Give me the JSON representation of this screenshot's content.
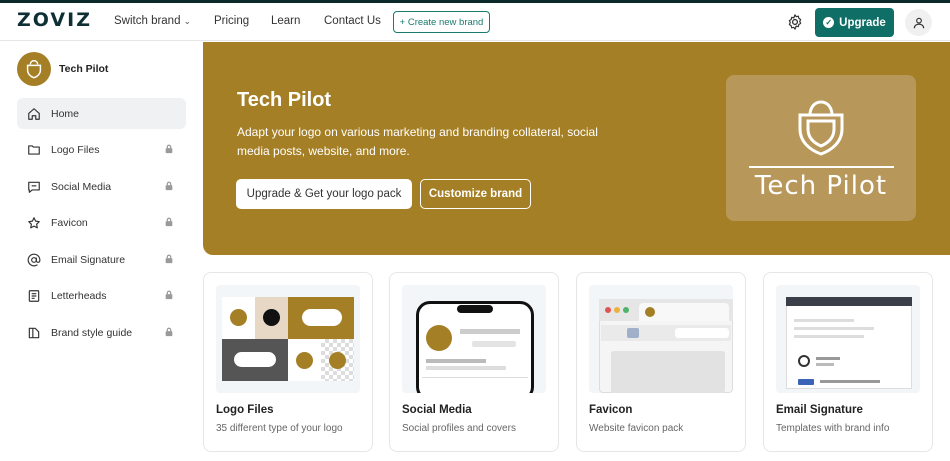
{
  "nav": {
    "logo": "ZOVIZ",
    "switch_brand": "Switch brand",
    "pricing": "Pricing",
    "learn": "Learn",
    "contact": "Contact Us",
    "create": "+ Create new brand",
    "upgrade": "Upgrade"
  },
  "sidebar": {
    "brand_name": "Tech Pilot",
    "items": [
      {
        "label": "Home",
        "icon": "home-icon",
        "locked": false
      },
      {
        "label": "Logo Files",
        "icon": "folder-icon",
        "locked": true
      },
      {
        "label": "Social Media",
        "icon": "chat-icon",
        "locked": true
      },
      {
        "label": "Favicon",
        "icon": "star-icon",
        "locked": true
      },
      {
        "label": "Email Signature",
        "icon": "at-icon",
        "locked": true
      },
      {
        "label": "Letterheads",
        "icon": "document-icon",
        "locked": true
      },
      {
        "label": "Brand style guide",
        "icon": "book-icon",
        "locked": true
      }
    ]
  },
  "hero": {
    "title": "Tech Pilot",
    "description": "Adapt your logo on various marketing and branding collateral, social media posts, website, and more.",
    "primary_button": "Upgrade & Get your logo pack",
    "secondary_button": "Customize brand",
    "preview_name": "Tech Pilot"
  },
  "cards": [
    {
      "title": "Logo Files",
      "subtitle": "35 different type of your logo"
    },
    {
      "title": "Social Media",
      "subtitle": "Social profiles and covers"
    },
    {
      "title": "Favicon",
      "subtitle": "Website favicon pack"
    },
    {
      "title": "Email Signature",
      "subtitle": "Templates with brand info"
    }
  ],
  "colors": {
    "brand_gold": "#a57f25",
    "accent_teal": "#0f6e66"
  }
}
